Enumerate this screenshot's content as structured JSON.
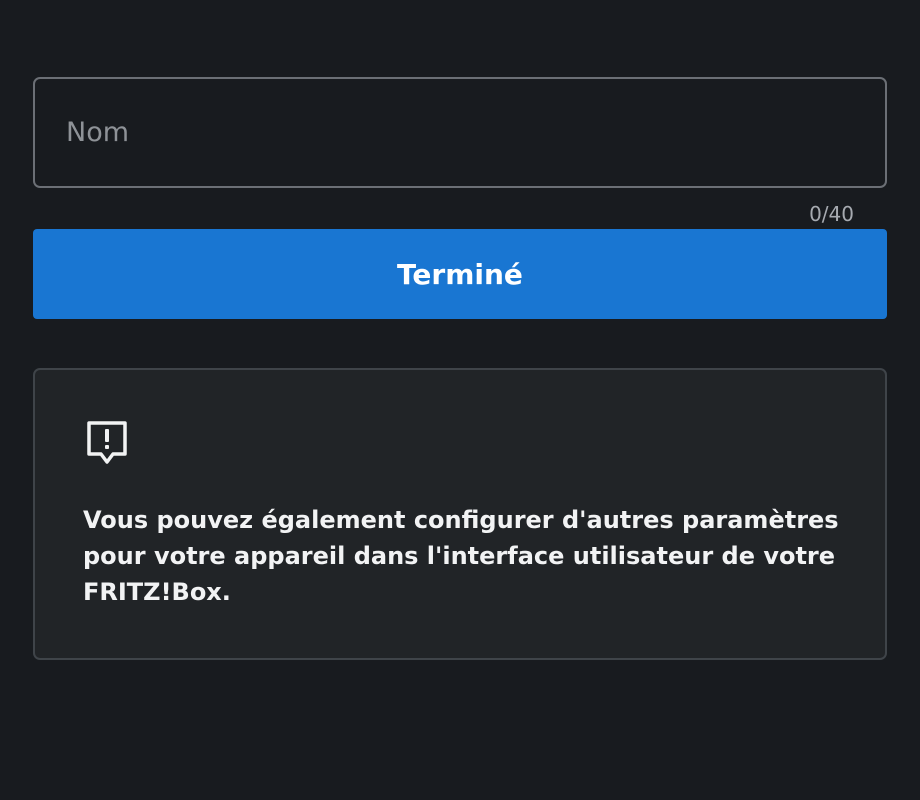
{
  "form": {
    "name_field": {
      "placeholder": "Nom",
      "value": ""
    },
    "char_counter": "0/40",
    "done_label": "Terminé"
  },
  "info_card": {
    "icon": "feedback-exclamation-icon",
    "text": "Vous pouvez également configurer d'autres paramètres pour votre appareil dans l'interface utilisateur de votre FRITZ!Box."
  },
  "colors": {
    "background": "#181b1f",
    "accent": "#1976d2",
    "card_background": "#212427"
  }
}
